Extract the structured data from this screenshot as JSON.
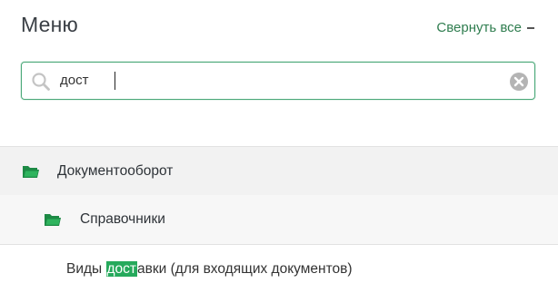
{
  "header": {
    "title": "Меню",
    "collapse_all_label": "Свернуть все"
  },
  "search": {
    "value": "дост",
    "placeholder": ""
  },
  "tree": {
    "folder": {
      "label": "Документооборот"
    },
    "subfolder": {
      "label": "Справочники"
    },
    "item": {
      "before": "Виды ",
      "match": "дост",
      "after": "авки (для входящих документов)"
    }
  },
  "colors": {
    "accent": "#2f7d4f",
    "highlight": "#26a95c",
    "search_border": "#4aa878"
  },
  "icons": [
    "search-icon",
    "clear-icon",
    "folder-open-icon",
    "minus-icon"
  ]
}
